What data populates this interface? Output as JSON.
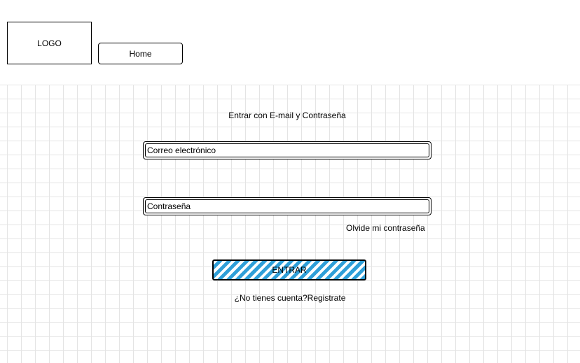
{
  "header": {
    "logo_text": "LOGO",
    "home_label": "Home"
  },
  "login": {
    "heading": "Entrar con E-mail y Contraseña",
    "email_placeholder": "Correo electrónico",
    "password_placeholder": "Contraseña",
    "forgot_label": "Olvide mi contraseña",
    "submit_label": "ENTRAR",
    "register_label": "¿No tienes cuenta?Registrate"
  },
  "colors": {
    "button_stripe": "#2f9fd8",
    "grid": "#e4e4e4"
  }
}
